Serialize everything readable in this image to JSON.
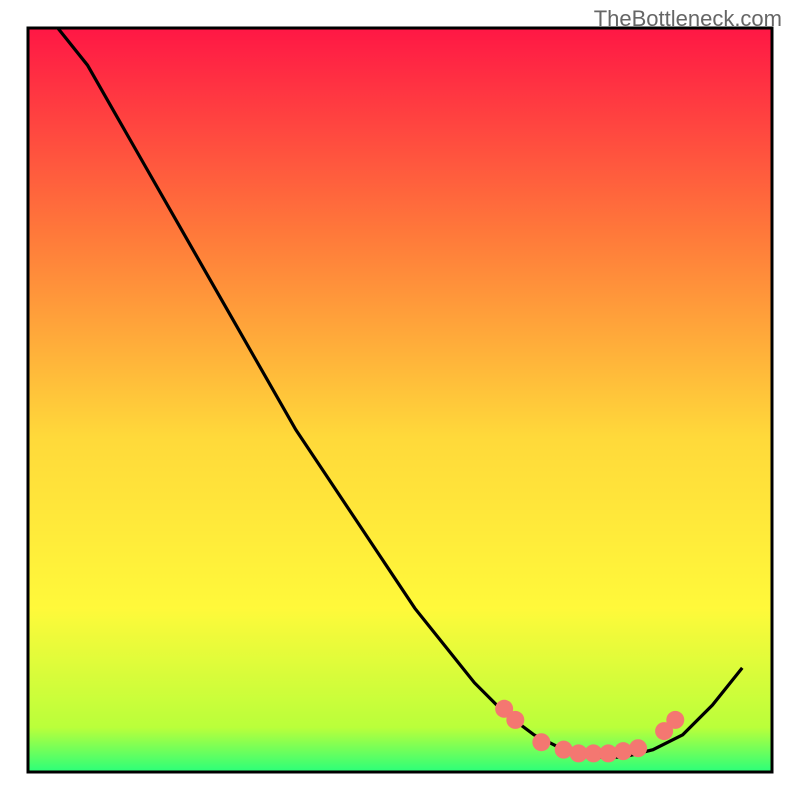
{
  "watermark": "TheBottleneck.com",
  "chart_data": {
    "type": "line",
    "title": "",
    "xlabel": "",
    "ylabel": "",
    "xlim": [
      0,
      100
    ],
    "ylim": [
      0,
      100
    ],
    "series": [
      {
        "name": "curve",
        "x": [
          4,
          8,
          12,
          16,
          20,
          24,
          28,
          32,
          36,
          40,
          44,
          48,
          52,
          56,
          60,
          64,
          68,
          72,
          76,
          80,
          84,
          88,
          92,
          96
        ],
        "y": [
          100,
          95,
          88,
          81,
          74,
          67,
          60,
          53,
          46,
          40,
          34,
          28,
          22,
          17,
          12,
          8,
          5,
          3,
          2,
          2,
          3,
          5,
          9,
          14
        ]
      },
      {
        "name": "markers",
        "x": [
          64,
          65.5,
          69,
          72,
          74,
          76,
          78,
          80,
          82,
          85.5,
          87
        ],
        "y": [
          8.5,
          7,
          4,
          3,
          2.5,
          2.5,
          2.5,
          2.8,
          3.2,
          5.5,
          7
        ]
      }
    ],
    "gradient_colors": {
      "top": "#ff1745",
      "upper_mid": "#ff7a3a",
      "mid": "#ffd93a",
      "lower_mid": "#fff93a",
      "bottom_band": "#baff3a",
      "bottom": "#2aff7a"
    },
    "border_color": "#000000",
    "curve_color": "#000000",
    "marker_color": "#f47771"
  }
}
